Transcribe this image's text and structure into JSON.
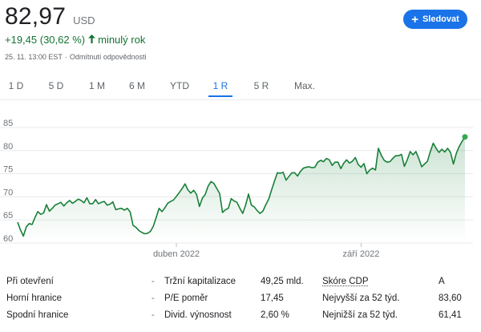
{
  "quote": {
    "price": "82,97",
    "currency": "USD",
    "change": "+19,45 (30,62 %)",
    "change_period": "minulý rok",
    "timestamp": "25. 11. 13:00 EST",
    "disclaimer": "Odmítnutí odpovědnosti"
  },
  "follow_button": {
    "label": "Sledovat",
    "color": "#1a73e8"
  },
  "tabs": [
    {
      "label": "1 D"
    },
    {
      "label": "5 D"
    },
    {
      "label": "1 M"
    },
    {
      "label": "6 M"
    },
    {
      "label": "YTD"
    },
    {
      "label": "1 R",
      "active": true
    },
    {
      "label": "5 R"
    },
    {
      "label": "Max."
    }
  ],
  "chart_data": {
    "type": "area",
    "y_ticks": [
      "85",
      "80",
      "75",
      "70",
      "65",
      "60"
    ],
    "ylim": [
      60,
      85
    ],
    "x_ticks": [
      "duben 2022",
      "září 2022"
    ],
    "grid": true,
    "line_color": "#188038",
    "series": [
      {
        "values": [
          64.5,
          62.8,
          61.5,
          63.5,
          64.2,
          64,
          65.5,
          66.8,
          66.2,
          66.5,
          68.3,
          66.9,
          67.5,
          68.2,
          68.5,
          68.8,
          68,
          68.7,
          69.2,
          68.6,
          69,
          69.5,
          69.2,
          68.7,
          69.8,
          68.5,
          68.5,
          69.4,
          68.5,
          68.8,
          69,
          68.2,
          68.4,
          68.9,
          67.2,
          67.4,
          67.5,
          67.1,
          67.5,
          66.7,
          63.8,
          63.4,
          62.7,
          62.3,
          62,
          62.1,
          62.5,
          63.6,
          65.5,
          67.5,
          66.8,
          67.6,
          68.6,
          69,
          69.3,
          70.1,
          70.9,
          71.8,
          72.8,
          71.5,
          70.8,
          71.4,
          70.5,
          67.9,
          69.7,
          70.5,
          72.3,
          73.3,
          72.9,
          71.8,
          70.7,
          66.6,
          67.2,
          67.5,
          69.6,
          69.1,
          68.8,
          67.5,
          66.4,
          68.2,
          70.6,
          68.2,
          67.8,
          67,
          66.4,
          66.9,
          68.3,
          69.5,
          71.5,
          73.4,
          75.2,
          75.1,
          75.3,
          73.6,
          74.4,
          75.2,
          75.2,
          74.5,
          75.5,
          76.2,
          76.4,
          76.5,
          76.3,
          76.4,
          77.5,
          77.9,
          77.6,
          78.3,
          78,
          76.8,
          77.5,
          77.5,
          76.1,
          77.3,
          78,
          77.3,
          77.7,
          78.5,
          77,
          76.4,
          77.2,
          75,
          75.8,
          76.2,
          75.8,
          80.5,
          79,
          77.9,
          77.5,
          77.6,
          78.3,
          78.9,
          78.9,
          79.2,
          76.6,
          78,
          79.8,
          79.1,
          79.8,
          78.3,
          76.5,
          77.1,
          77.7,
          79.8,
          81.6,
          80.5,
          79.6,
          80.3,
          79.7,
          80.5,
          79.6,
          77.1,
          79.4,
          80.9,
          82,
          82.97
        ]
      }
    ]
  },
  "stats": {
    "col1": [
      {
        "label": "Při otevření",
        "value": "-"
      },
      {
        "label": "Horní hranice",
        "value": "-"
      },
      {
        "label": "Spodní hranice",
        "value": "-"
      }
    ],
    "col2": [
      {
        "label": "Tržní kapitalizace",
        "value": "49,25 mld."
      },
      {
        "label": "P/E poměr",
        "value": "17,45"
      },
      {
        "label": "Divid. výnosnost",
        "value": "2,60 %"
      }
    ],
    "col3": [
      {
        "label": "Skóre CDP",
        "value": "A"
      },
      {
        "label": "Nejvyšší za 52 týd.",
        "value": "83,60"
      },
      {
        "label": "Nejnižší za 52 týd.",
        "value": "61,41"
      }
    ]
  }
}
